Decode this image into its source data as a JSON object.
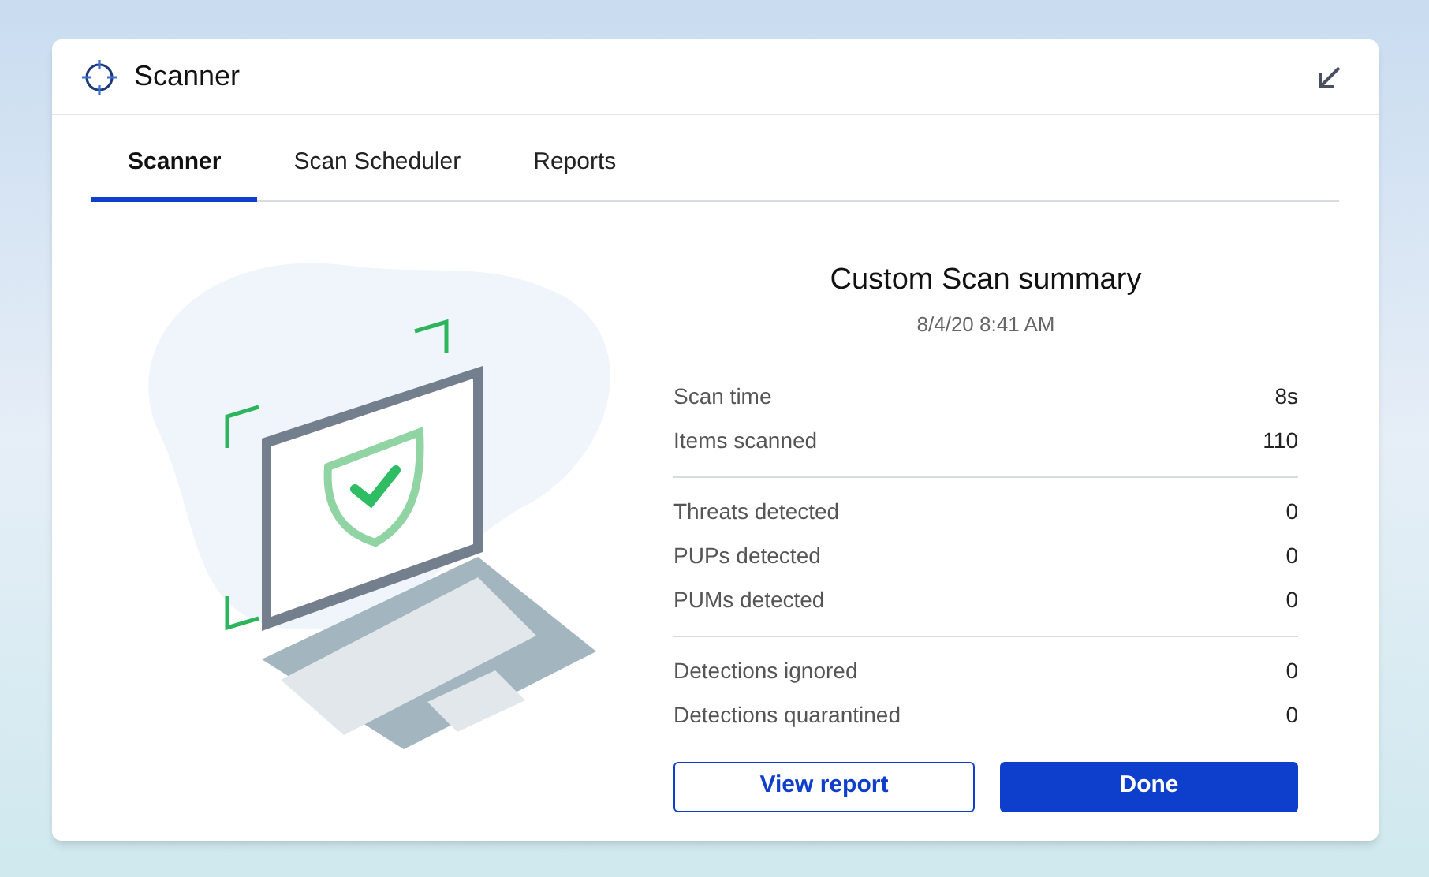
{
  "window": {
    "title": "Scanner"
  },
  "tabs": [
    {
      "label": "Scanner",
      "selected": true
    },
    {
      "label": "Scan Scheduler",
      "selected": false
    },
    {
      "label": "Reports",
      "selected": false
    }
  ],
  "summary": {
    "title": "Custom Scan summary",
    "date": "8/4/20 8:41 AM",
    "groups": [
      [
        {
          "label": "Scan time",
          "value": "8s"
        },
        {
          "label": "Items scanned",
          "value": "110"
        }
      ],
      [
        {
          "label": "Threats detected",
          "value": "0"
        },
        {
          "label": "PUPs detected",
          "value": "0"
        },
        {
          "label": "PUMs detected",
          "value": "0"
        }
      ],
      [
        {
          "label": "Detections ignored",
          "value": "0"
        },
        {
          "label": "Detections quarantined",
          "value": "0"
        }
      ]
    ]
  },
  "buttons": [
    {
      "label": "View report",
      "kind": "secondary"
    },
    {
      "label": "Done",
      "kind": "primary"
    }
  ]
}
